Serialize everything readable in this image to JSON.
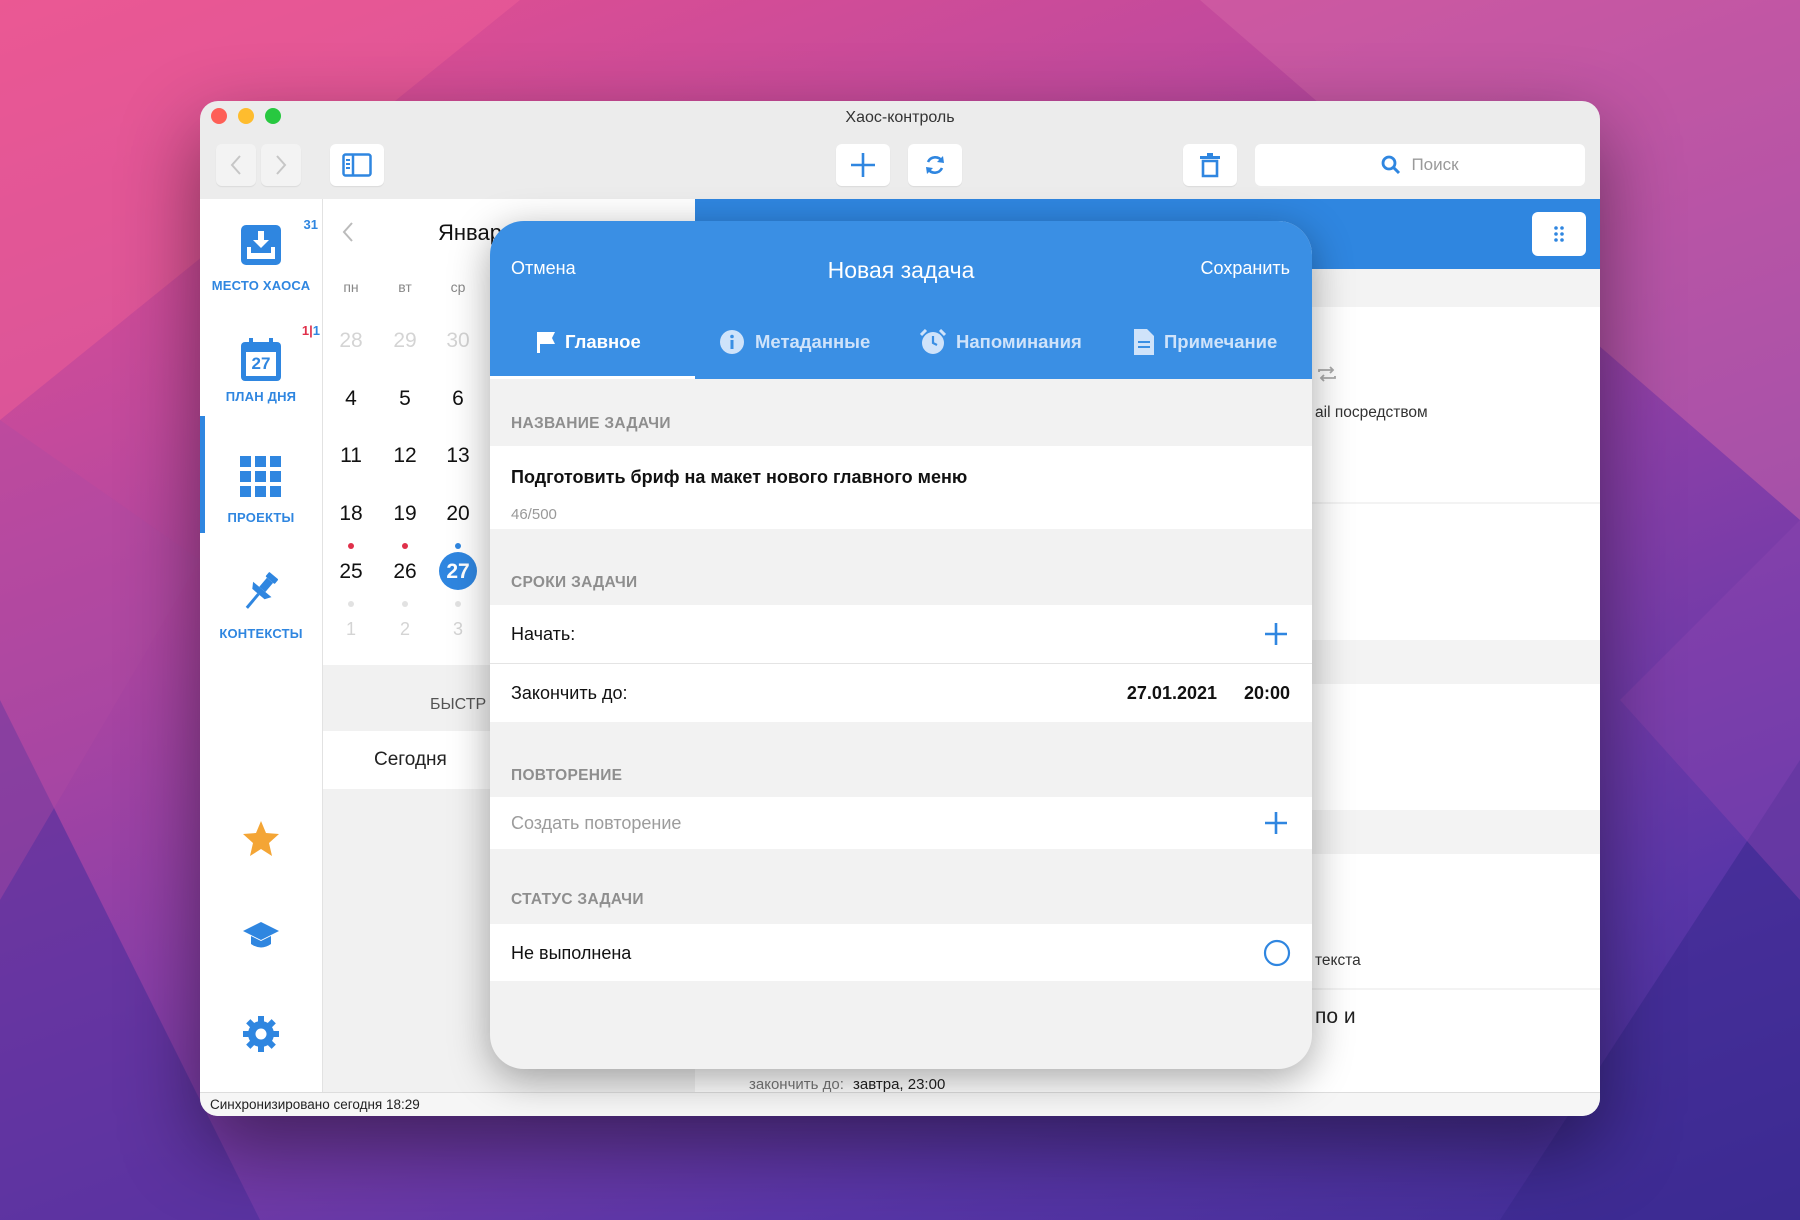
{
  "window": {
    "title": "Хаос-контроль"
  },
  "toolbar": {
    "search_placeholder": "Поиск"
  },
  "sidebar": {
    "items": [
      {
        "label": "МЕСТО ХАОСА",
        "badge": "31",
        "icon": "inbox-icon"
      },
      {
        "label": "ПЛАН ДНЯ",
        "badge_red": "1",
        "badge_sep": "|",
        "badge_blue": "1",
        "icon": "calendar-icon",
        "icon_text": "27"
      },
      {
        "label": "ПРОЕКТЫ",
        "icon": "grid-icon"
      },
      {
        "label": "КОНТЕКСТЫ",
        "icon": "pin-icon"
      }
    ],
    "bottom_icons": [
      "star-icon",
      "graduation-cap-icon",
      "gear-icon"
    ]
  },
  "calendar": {
    "month_partial": "Январ",
    "weekdays": [
      "пн",
      "вт",
      "ср"
    ],
    "rows": [
      [
        "28",
        "29",
        "30"
      ],
      [
        "4",
        "5",
        "6"
      ],
      [
        "11",
        "12",
        "13"
      ],
      [
        "18",
        "19",
        "20"
      ],
      [
        "25",
        "26",
        "27"
      ],
      [
        "1",
        "2",
        "3"
      ]
    ],
    "quick_label_partial": "БЫСТР",
    "today_label": "Сегодня"
  },
  "right_pane": {
    "snippet_email": "ail посредством",
    "snippet_context": "текста",
    "snippet_title": "по и",
    "snippet_due_label": "закончить до:",
    "snippet_due_value": "завтра, 23:00"
  },
  "status_bar": {
    "text": "Синхронизировано сегодня 18:29"
  },
  "modal": {
    "cancel": "Отмена",
    "title": "Новая задача",
    "save": "Сохранить",
    "tabs": [
      {
        "label": "Главное",
        "icon": "flag-icon"
      },
      {
        "label": "Метаданные",
        "icon": "info-icon"
      },
      {
        "label": "Напоминания",
        "icon": "alarm-clock-icon"
      },
      {
        "label": "Примечание",
        "icon": "document-icon"
      }
    ],
    "section_name": "НАЗВАНИЕ ЗАДАЧИ",
    "task_name": "Подготовить бриф на макет нового главного меню",
    "char_count": "46/500",
    "section_dates": "СРОКИ ЗАДАЧИ",
    "start_label": "Начать:",
    "due_label": "Закончить до:",
    "due_date": "27.01.2021",
    "due_time": "20:00",
    "section_repeat": "ПОВТОРЕНИЕ",
    "repeat_placeholder": "Создать повторение",
    "section_status": "СТАТУС ЗАДАЧИ",
    "status_value": "Не выполнена"
  },
  "colors": {
    "accent": "#2f86e0",
    "modal_header": "#3a8fe4",
    "badge_red": "#e0304a",
    "star": "#f4a535"
  }
}
